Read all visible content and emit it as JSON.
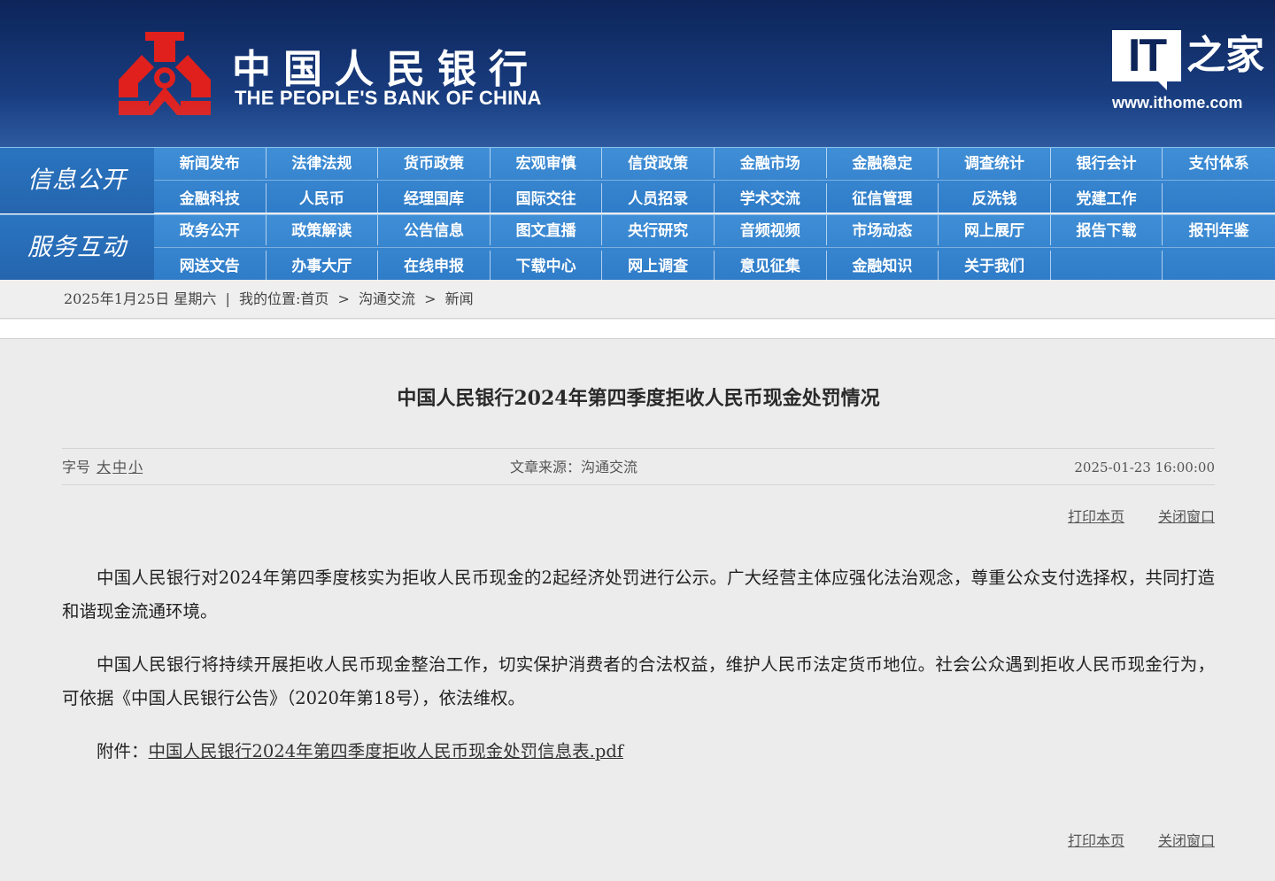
{
  "header": {
    "bank_name_cn": "中国人民银行",
    "bank_name_en": "THE PEOPLE'S BANK OF CHINA",
    "watermark_logo_text": "IT",
    "watermark_logo_cn": "之家",
    "watermark_url": "www.ithome.com",
    "colors": {
      "banner": "#17397a",
      "emblem": "#e0201c",
      "nav": "#3a88d2"
    }
  },
  "nav": {
    "block1_label": "信息公开",
    "block1_row1": [
      "新闻发布",
      "法律法规",
      "货币政策",
      "宏观审慎",
      "信贷政策",
      "金融市场",
      "金融稳定",
      "调查统计",
      "银行会计",
      "支付体系"
    ],
    "block1_row2": [
      "金融科技",
      "人民币",
      "经理国库",
      "国际交往",
      "人员招录",
      "学术交流",
      "征信管理",
      "反洗钱",
      "党建工作",
      ""
    ],
    "block2_label": "服务互动",
    "block2_row1": [
      "政务公开",
      "政策解读",
      "公告信息",
      "图文直播",
      "央行研究",
      "音频视频",
      "市场动态",
      "网上展厅",
      "报告下载",
      "报刊年鉴"
    ],
    "block2_row2": [
      "网送文告",
      "办事大厅",
      "在线申报",
      "下载中心",
      "网上调查",
      "意见征集",
      "金融知识",
      "关于我们",
      "",
      ""
    ]
  },
  "breadcrumb": {
    "date": "2025年1月25日 星期六",
    "sep": "|",
    "prefix": "我的位置:",
    "home": "首页",
    "arrow": ">",
    "level1": "沟通交流",
    "level2": "新闻"
  },
  "article": {
    "title": "中国人民银行2024年第四季度拒收人民币现金处罚情况",
    "font_size_label": "字号",
    "font_large": "大",
    "font_medium": "中",
    "font_small": "小",
    "source": "文章来源：沟通交流",
    "pub_datetime": "2025-01-23 16:00:00",
    "print_label": "打印本页",
    "close_label": "关闭窗口",
    "paragraph1": "中国人民银行对2024年第四季度核实为拒收人民币现金的2起经济处罚进行公示。广大经营主体应强化法治观念，尊重公众支付选择权，共同打造和谐现金流通环境。",
    "paragraph2": "中国人民银行将持续开展拒收人民币现金整治工作，切实保护消费者的合法权益，维护人民币法定货币地位。社会公众遇到拒收人民币现金行为，可依据《中国人民银行公告》（2020年第18号），依法维权。",
    "attachment_label": "附件：",
    "attachment_link": "中国人民银行2024年第四季度拒收人民币现金处罚信息表.pdf"
  }
}
